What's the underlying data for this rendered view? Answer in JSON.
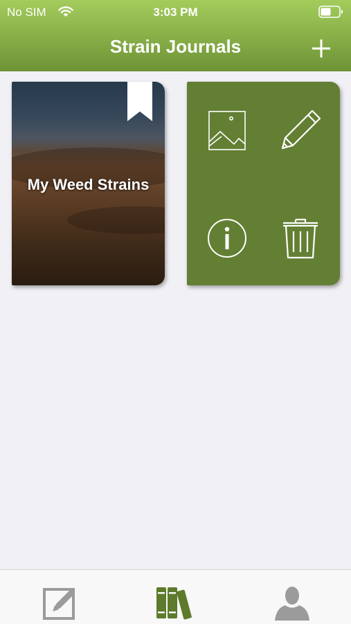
{
  "status_bar": {
    "carrier": "No SIM",
    "time": "3:03 PM"
  },
  "nav": {
    "title": "Strain Journals"
  },
  "journals": [
    {
      "title": "My Weed Strains"
    }
  ],
  "colors": {
    "header_green": "#8db14c",
    "card_green": "#637f33",
    "tab_active": "#5e7a2c",
    "tab_inactive": "#9b9b9b",
    "background": "#f0f0f5"
  },
  "icons": {
    "add": "plus-icon",
    "bookmark": "bookmark-icon",
    "cover": "image-icon",
    "edit": "pencil-icon",
    "info": "info-icon",
    "delete": "trash-icon",
    "tab_entries": "edit-note-icon",
    "tab_journals": "books-icon",
    "tab_profile": "person-icon"
  },
  "tabs": {
    "active": "journals"
  }
}
